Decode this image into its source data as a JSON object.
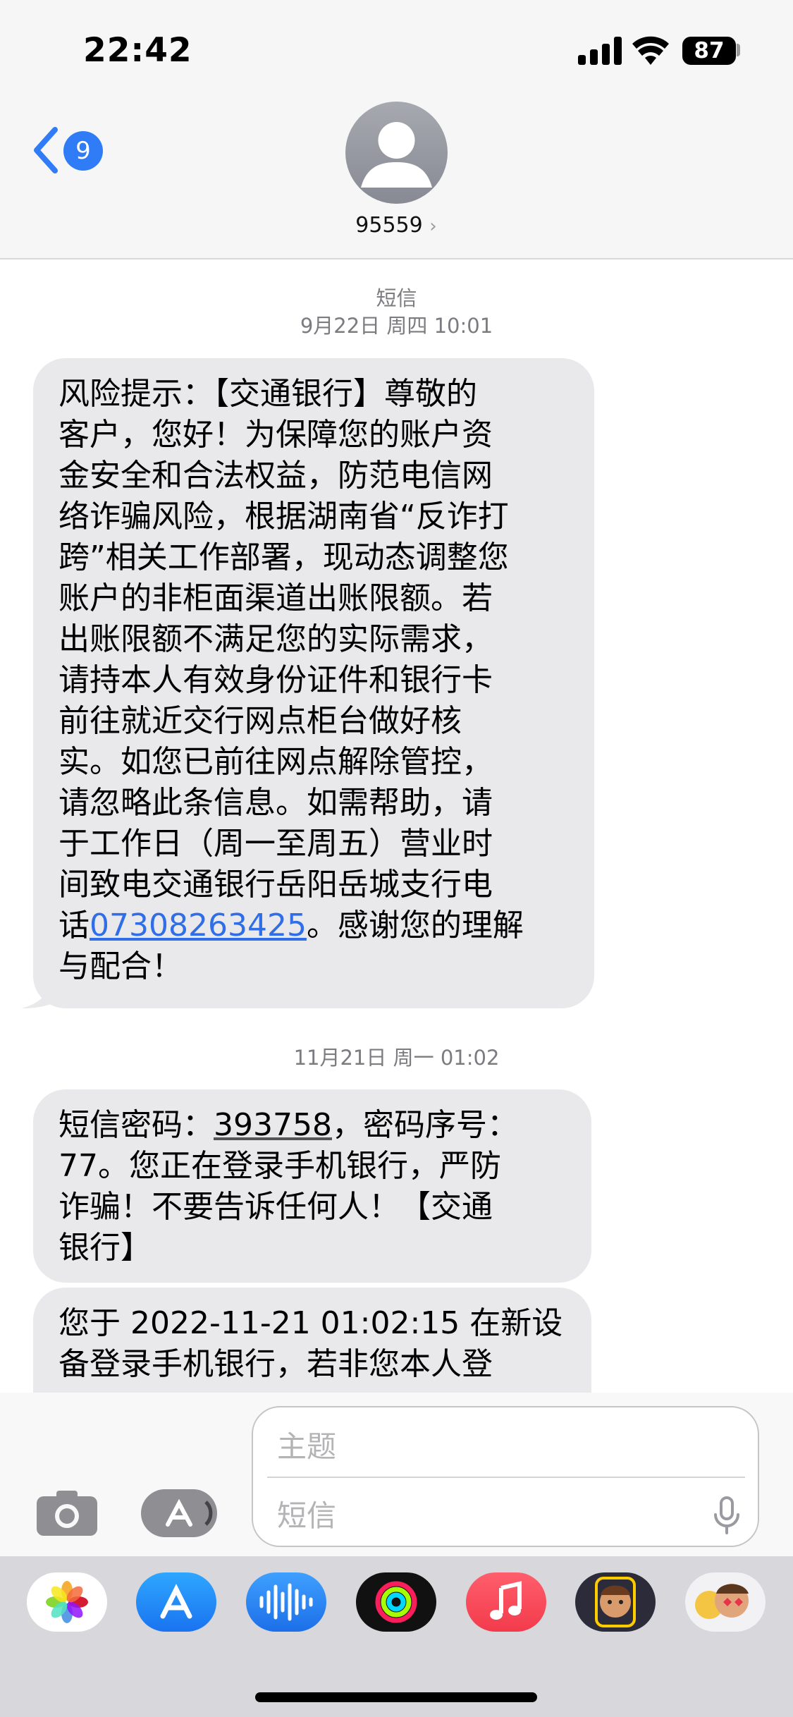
{
  "status_bar": {
    "time": "22:42",
    "battery": "87"
  },
  "nav": {
    "back_count": "9",
    "contact": "95559",
    "contact_chevron": "›"
  },
  "thread": {
    "stamp1_type": "短信",
    "stamp1_date": "9月22日 周四 10:01",
    "message1_lines": [
      "风险提示：【交通银行】尊敬的",
      "客户，您好！为保障您的账户资",
      "金安全和合法权益，防范电信网",
      "络诈骗风险，根据湖南省“反诈打",
      "跨”相关工作部署，现动态调整您",
      "账户的非柜面渠道出账限额。若",
      "出账限额不满足您的实际需求，",
      "请持本人有效身份证件和银行卡",
      "前往就近交行网点柜台做好核",
      "实。如您已前往网点解除管控，",
      "请忽略此条信息。如需帮助，请",
      "于工作日（周一至周五）营业时",
      "间致电交通银行岳阳岳城支行电"
    ],
    "message1_phone_prefix": "话",
    "message1_phone": "07308263425",
    "message1_phone_suffix": "。感谢您的理解",
    "message1_last": "与配合！",
    "stamp2_date": "11月21日 周一 01:02",
    "message2_prefix": "短信密码：",
    "message2_code": "393758",
    "message2_line1_suffix": "，密码序号：",
    "message2_lines": [
      "77。您正在登录手机银行，严防",
      "诈骗！不要告诉任何人！【交通",
      "银行】"
    ],
    "message3_lines": [
      "您于 2022-11-21 01:02:15 在新设",
      "备登录手机银行，若非您本人登"
    ]
  },
  "composer": {
    "subject_placeholder": "主题",
    "message_placeholder": "短信"
  },
  "app_tray": {
    "apps": [
      "photos-icon",
      "app-store-icon",
      "voice-memos-icon",
      "fitness-icon",
      "music-icon",
      "memoji-icon",
      "memoji-stickers-icon"
    ]
  }
}
